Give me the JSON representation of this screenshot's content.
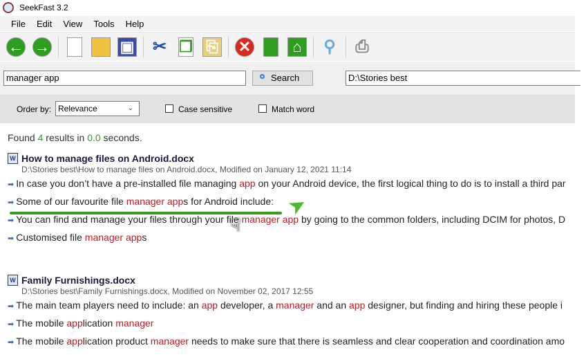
{
  "window": {
    "title": "SeekFast 3.2"
  },
  "menu": [
    "File",
    "Edit",
    "View",
    "Tools",
    "Help"
  ],
  "toolbar": [
    {
      "icon": "back-icon",
      "color": "#2e9e1e"
    },
    {
      "icon": "forward-icon",
      "color": "#2e9e1e"
    },
    {
      "icon": "new-document-icon",
      "color": "#ffffff"
    },
    {
      "icon": "open-folder-icon",
      "color": "#f0c040"
    },
    {
      "icon": "save-icon",
      "color": "#3b4aa8"
    },
    {
      "icon": "cut-icon",
      "color": "#1f4fa8"
    },
    {
      "icon": "copy-icon",
      "color": "#ffffff"
    },
    {
      "icon": "paste-icon",
      "color": "#e8cf7a"
    },
    {
      "icon": "stop-icon",
      "color": "#d9281e"
    },
    {
      "icon": "refresh-icon",
      "color": "#2e9e1e"
    },
    {
      "icon": "home-icon",
      "color": "#2e9e1e"
    },
    {
      "icon": "find-icon",
      "color": "#6aa8e0"
    },
    {
      "icon": "print-icon",
      "color": "#888888"
    }
  ],
  "search": {
    "query": "manager app",
    "button": "Search",
    "path": "D:\\Stories best"
  },
  "options": {
    "order_label": "Order by:",
    "order_value": "Relevance",
    "case_sensitive": "Case sensitive",
    "match_word": "Match word"
  },
  "summary": {
    "prefix": "Found ",
    "count": "4",
    "middle": " results in ",
    "time": "0.0",
    "suffix": " seconds."
  },
  "results": [
    {
      "title": "How to manage files on Android.docx",
      "path": "D:\\Stories best\\How to manage files on Android.docx, Modified on January 12, 2021 11:14",
      "snippets": [
        [
          {
            "t": "In case you don’t have a pre-installed file managing "
          },
          {
            "t": "app",
            "hl": true
          },
          {
            "t": " on your Android device, the first logical thing to do is to install a third par"
          }
        ],
        [
          {
            "t": "Some of our favourite file "
          },
          {
            "t": "manager app",
            "hl": true
          },
          {
            "t": "s for Android include:"
          }
        ],
        [
          {
            "t": "You can find and manage your files through your file "
          },
          {
            "t": "manager app",
            "hl": true
          },
          {
            "t": " by going to the common folders, including DCIM for photos, D"
          }
        ],
        [
          {
            "t": "Customised file "
          },
          {
            "t": "manager app",
            "hl": true
          },
          {
            "t": "s"
          }
        ]
      ]
    },
    {
      "title": "Family Furnishings.docx",
      "path": "D:\\Stories best\\Family Furnishings.docx, Modified on November 02, 2017 12:55",
      "snippets": [
        [
          {
            "t": "The main team players need to include: an "
          },
          {
            "t": "app",
            "hl": true
          },
          {
            "t": " developer, a "
          },
          {
            "t": "manager",
            "hl": true
          },
          {
            "t": " and an "
          },
          {
            "t": "app",
            "hl": true
          },
          {
            "t": " designer, but finding and hiring these people i"
          }
        ],
        [
          {
            "t": "The mobile "
          },
          {
            "t": "app",
            "hl": true
          },
          {
            "t": "lication "
          },
          {
            "t": "manager",
            "hl": true
          }
        ],
        [
          {
            "t": "The mobile "
          },
          {
            "t": "app",
            "hl": true
          },
          {
            "t": "lication product "
          },
          {
            "t": "manager",
            "hl": true
          },
          {
            "t": " needs to make sure that there is seamless and clear cooperation and coordination amo"
          }
        ]
      ]
    }
  ]
}
